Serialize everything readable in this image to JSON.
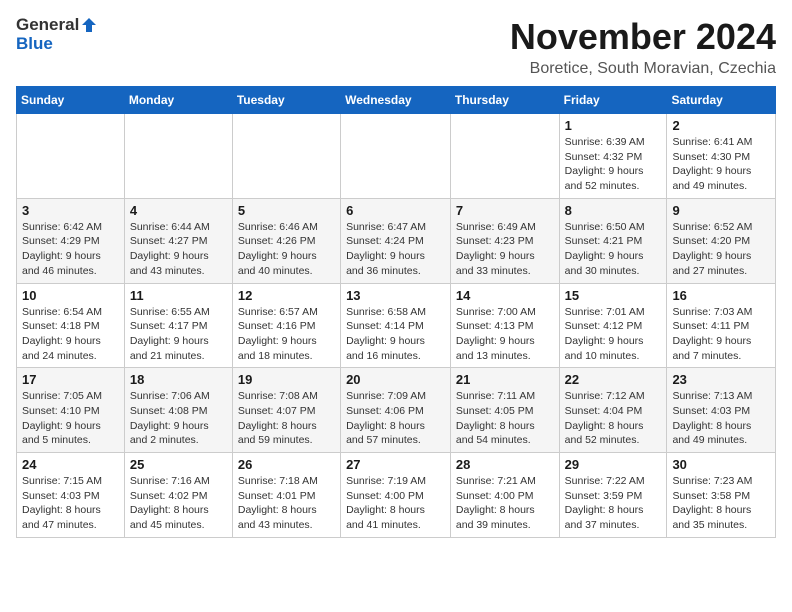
{
  "header": {
    "logo_general": "General",
    "logo_blue": "Blue",
    "month_year": "November 2024",
    "location": "Boretice, South Moravian, Czechia"
  },
  "days_of_week": [
    "Sunday",
    "Monday",
    "Tuesday",
    "Wednesday",
    "Thursday",
    "Friday",
    "Saturday"
  ],
  "weeks": [
    [
      {
        "day": "",
        "detail": ""
      },
      {
        "day": "",
        "detail": ""
      },
      {
        "day": "",
        "detail": ""
      },
      {
        "day": "",
        "detail": ""
      },
      {
        "day": "",
        "detail": ""
      },
      {
        "day": "1",
        "detail": "Sunrise: 6:39 AM\nSunset: 4:32 PM\nDaylight: 9 hours and 52 minutes."
      },
      {
        "day": "2",
        "detail": "Sunrise: 6:41 AM\nSunset: 4:30 PM\nDaylight: 9 hours and 49 minutes."
      }
    ],
    [
      {
        "day": "3",
        "detail": "Sunrise: 6:42 AM\nSunset: 4:29 PM\nDaylight: 9 hours and 46 minutes."
      },
      {
        "day": "4",
        "detail": "Sunrise: 6:44 AM\nSunset: 4:27 PM\nDaylight: 9 hours and 43 minutes."
      },
      {
        "day": "5",
        "detail": "Sunrise: 6:46 AM\nSunset: 4:26 PM\nDaylight: 9 hours and 40 minutes."
      },
      {
        "day": "6",
        "detail": "Sunrise: 6:47 AM\nSunset: 4:24 PM\nDaylight: 9 hours and 36 minutes."
      },
      {
        "day": "7",
        "detail": "Sunrise: 6:49 AM\nSunset: 4:23 PM\nDaylight: 9 hours and 33 minutes."
      },
      {
        "day": "8",
        "detail": "Sunrise: 6:50 AM\nSunset: 4:21 PM\nDaylight: 9 hours and 30 minutes."
      },
      {
        "day": "9",
        "detail": "Sunrise: 6:52 AM\nSunset: 4:20 PM\nDaylight: 9 hours and 27 minutes."
      }
    ],
    [
      {
        "day": "10",
        "detail": "Sunrise: 6:54 AM\nSunset: 4:18 PM\nDaylight: 9 hours and 24 minutes."
      },
      {
        "day": "11",
        "detail": "Sunrise: 6:55 AM\nSunset: 4:17 PM\nDaylight: 9 hours and 21 minutes."
      },
      {
        "day": "12",
        "detail": "Sunrise: 6:57 AM\nSunset: 4:16 PM\nDaylight: 9 hours and 18 minutes."
      },
      {
        "day": "13",
        "detail": "Sunrise: 6:58 AM\nSunset: 4:14 PM\nDaylight: 9 hours and 16 minutes."
      },
      {
        "day": "14",
        "detail": "Sunrise: 7:00 AM\nSunset: 4:13 PM\nDaylight: 9 hours and 13 minutes."
      },
      {
        "day": "15",
        "detail": "Sunrise: 7:01 AM\nSunset: 4:12 PM\nDaylight: 9 hours and 10 minutes."
      },
      {
        "day": "16",
        "detail": "Sunrise: 7:03 AM\nSunset: 4:11 PM\nDaylight: 9 hours and 7 minutes."
      }
    ],
    [
      {
        "day": "17",
        "detail": "Sunrise: 7:05 AM\nSunset: 4:10 PM\nDaylight: 9 hours and 5 minutes."
      },
      {
        "day": "18",
        "detail": "Sunrise: 7:06 AM\nSunset: 4:08 PM\nDaylight: 9 hours and 2 minutes."
      },
      {
        "day": "19",
        "detail": "Sunrise: 7:08 AM\nSunset: 4:07 PM\nDaylight: 8 hours and 59 minutes."
      },
      {
        "day": "20",
        "detail": "Sunrise: 7:09 AM\nSunset: 4:06 PM\nDaylight: 8 hours and 57 minutes."
      },
      {
        "day": "21",
        "detail": "Sunrise: 7:11 AM\nSunset: 4:05 PM\nDaylight: 8 hours and 54 minutes."
      },
      {
        "day": "22",
        "detail": "Sunrise: 7:12 AM\nSunset: 4:04 PM\nDaylight: 8 hours and 52 minutes."
      },
      {
        "day": "23",
        "detail": "Sunrise: 7:13 AM\nSunset: 4:03 PM\nDaylight: 8 hours and 49 minutes."
      }
    ],
    [
      {
        "day": "24",
        "detail": "Sunrise: 7:15 AM\nSunset: 4:03 PM\nDaylight: 8 hours and 47 minutes."
      },
      {
        "day": "25",
        "detail": "Sunrise: 7:16 AM\nSunset: 4:02 PM\nDaylight: 8 hours and 45 minutes."
      },
      {
        "day": "26",
        "detail": "Sunrise: 7:18 AM\nSunset: 4:01 PM\nDaylight: 8 hours and 43 minutes."
      },
      {
        "day": "27",
        "detail": "Sunrise: 7:19 AM\nSunset: 4:00 PM\nDaylight: 8 hours and 41 minutes."
      },
      {
        "day": "28",
        "detail": "Sunrise: 7:21 AM\nSunset: 4:00 PM\nDaylight: 8 hours and 39 minutes."
      },
      {
        "day": "29",
        "detail": "Sunrise: 7:22 AM\nSunset: 3:59 PM\nDaylight: 8 hours and 37 minutes."
      },
      {
        "day": "30",
        "detail": "Sunrise: 7:23 AM\nSunset: 3:58 PM\nDaylight: 8 hours and 35 minutes."
      }
    ]
  ]
}
